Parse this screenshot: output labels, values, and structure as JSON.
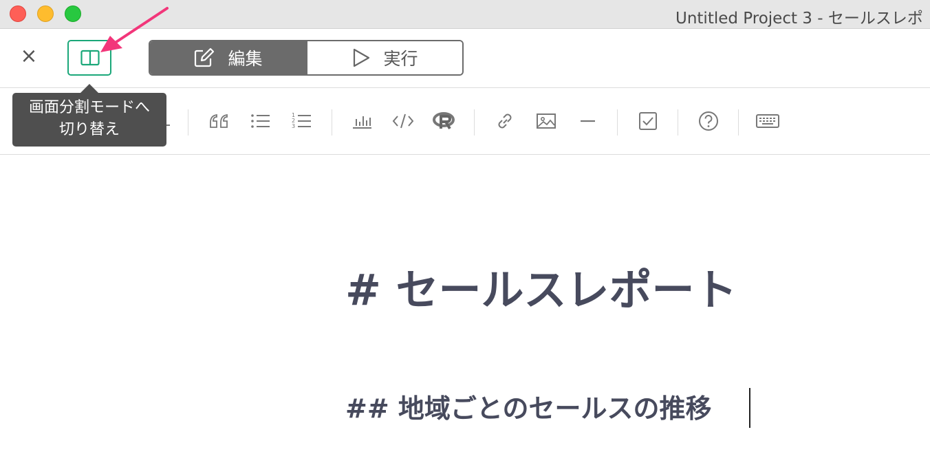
{
  "window": {
    "title": "Untitled Project 3 - セールスレポ"
  },
  "topbar": {
    "close_label": "×",
    "mode_tabs": [
      {
        "label": "編集",
        "icon": "pencil-square-icon",
        "active": true
      },
      {
        "label": "実行",
        "icon": "play-icon",
        "active": false
      }
    ]
  },
  "tooltip": {
    "line1": "画面分割モードへ",
    "line2": "切り替え"
  },
  "format_toolbar": {
    "icons": [
      "quote-icon",
      "bullet-list-icon",
      "numbered-list-icon",
      "chart-icon",
      "code-icon",
      "r-logo-icon",
      "link-icon",
      "image-icon",
      "horizontal-rule-icon",
      "checkbox-icon",
      "help-icon",
      "keyboard-icon"
    ]
  },
  "editor": {
    "heading1": "# セールスレポート",
    "heading2": "## 地域ごとのセールスの推移"
  },
  "colors": {
    "accent": "#1aa779",
    "annotation_arrow": "#f2367a",
    "tab_active_bg": "#6b6b6b",
    "heading_text": "#474a5d"
  }
}
